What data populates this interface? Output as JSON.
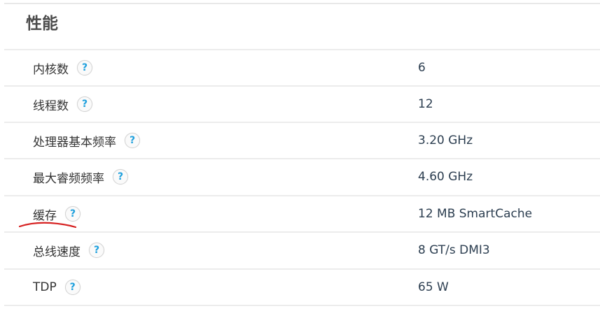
{
  "section": {
    "title": "性能"
  },
  "help_icon_glyph": "?",
  "specs": [
    {
      "label": "内核数",
      "value": "6"
    },
    {
      "label": "线程数",
      "value": "12"
    },
    {
      "label": "处理器基本频率",
      "value": "3.20 GHz"
    },
    {
      "label": "最大睿频频率",
      "value": "4.60 GHz"
    },
    {
      "label": "缓存",
      "value": "12 MB SmartCache"
    },
    {
      "label": "总线速度",
      "value": "8 GT/s DMI3"
    },
    {
      "label": "TDP",
      "value": "65 W"
    }
  ],
  "colors": {
    "help_icon": "#1fa0dd",
    "annotation_underline": "#d62020",
    "row_divider": "#ececec"
  },
  "annotation": {
    "type": "hand-drawn red underline",
    "target": "缓存"
  }
}
